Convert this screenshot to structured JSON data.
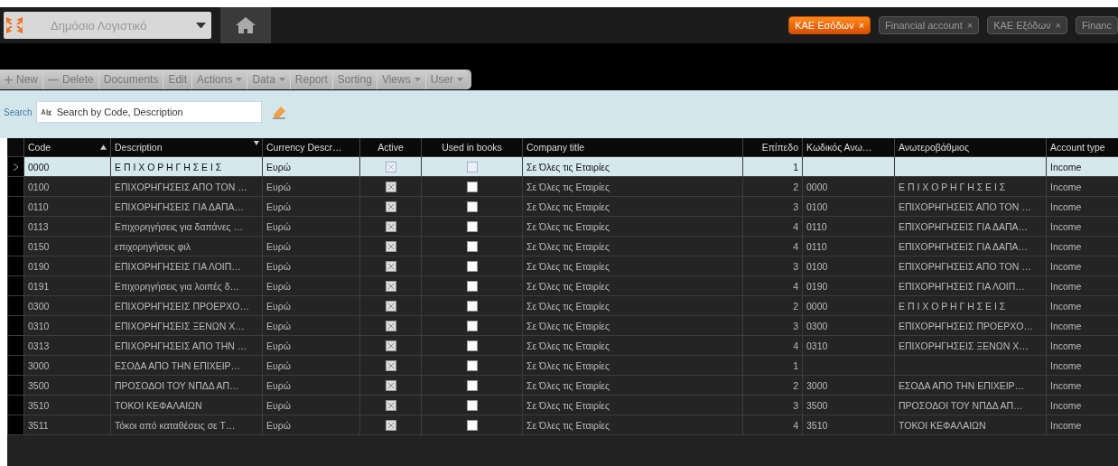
{
  "app_selector": {
    "value": "Δημόσιο Λογιστικό"
  },
  "open_tabs": [
    {
      "label": "ΚΑΕ Εσόδων",
      "close": "×",
      "selected": true
    },
    {
      "label": "Financial account",
      "close": "×",
      "selected": false
    },
    {
      "label": "ΚΑΕ Εξόδων",
      "close": "×",
      "selected": false
    },
    {
      "label": "Financ",
      "selected": false
    }
  ],
  "toolbar": [
    {
      "label": "New",
      "kind": "add"
    },
    {
      "label": "Delete",
      "kind": "remove"
    },
    {
      "label": "Documents",
      "kind": "plain"
    },
    {
      "label": "Edit",
      "kind": "plain"
    },
    {
      "label": "Actions",
      "kind": "menu"
    },
    {
      "label": "Data",
      "kind": "menu"
    },
    {
      "label": "Report",
      "kind": "plain"
    },
    {
      "label": "Sorting",
      "kind": "plain"
    },
    {
      "label": "Views",
      "kind": "menu"
    },
    {
      "label": "User",
      "kind": "menu"
    }
  ],
  "search": {
    "label": "Search",
    "placeholder": "Search by Code, Description"
  },
  "table": {
    "columns": [
      {
        "label": "Code",
        "sorted_ascending": true,
        "filter_mark": false
      },
      {
        "label": "Description",
        "sorted_ascending": false,
        "filter_mark": true
      },
      {
        "label": "Currency Descr…",
        "sorted_ascending": false,
        "filter_mark": false
      },
      {
        "label": "Active",
        "sorted_ascending": false,
        "filter_mark": false
      },
      {
        "label": "Used in books",
        "sorted_ascending": false,
        "filter_mark": false
      },
      {
        "label": "Company title",
        "sorted_ascending": false,
        "filter_mark": false
      },
      {
        "label": "Επίπεδο",
        "sorted_ascending": false,
        "filter_mark": false
      },
      {
        "label": "Κωδικός Ανω…",
        "sorted_ascending": false,
        "filter_mark": false
      },
      {
        "label": "Ανωτεροβάθμιος",
        "sorted_ascending": false,
        "filter_mark": false
      },
      {
        "label": "Account type",
        "sorted_ascending": false,
        "filter_mark": false
      }
    ],
    "rows": [
      {
        "selected": true,
        "code": "0000",
        "description": "Ε Π Ι Χ Ο Ρ Η Γ Η Σ Ε Ι Σ",
        "currency": "Ευρώ",
        "active": true,
        "used_in_books": false,
        "company": "Σε Όλες τις Εταιρίες",
        "level_no": "1",
        "account_type": "Income"
      },
      {
        "selected": false,
        "code": "0100",
        "description": "ΕΠΙΧΟΡΗΓΗΣΕΙΣ ΑΠΟ ΤΟΝ …",
        "currency": "Ευρώ",
        "active": true,
        "used_in_books": false,
        "company": "Σε Όλες τις Εταιρίες",
        "level_no": "2",
        "parent_code": "0000",
        "parent": "Ε Π Ι Χ Ο Ρ Η Γ Η Σ Ε Ι Σ",
        "account_type": "Income"
      },
      {
        "selected": false,
        "code": "0110",
        "description": "ΕΠΙΧΟΡΗΓΗΣΕΙΣ ΓΙΑ ΔΑΠΑ…",
        "currency": "Ευρώ",
        "active": true,
        "used_in_books": false,
        "company": "Σε Όλες τις Εταιρίες",
        "level_no": "3",
        "parent_code": "0100",
        "parent": "ΕΠΙΧΟΡΗΓΗΣΕΙΣ ΑΠΟ ΤΟΝ …",
        "account_type": "Income"
      },
      {
        "selected": false,
        "code": "0113",
        "description": "Επιχορηγήσεις για δαπάνες …",
        "currency": "Ευρώ",
        "active": true,
        "used_in_books": false,
        "company": "Σε Όλες τις Εταιρίες",
        "level_no": "4",
        "parent_code": "0110",
        "parent": "ΕΠΙΧΟΡΗΓΗΣΕΙΣ ΓΙΑ ΔΑΠΑ…",
        "account_type": "Income"
      },
      {
        "selected": false,
        "code": "0150",
        "description": "επιχορηγήσεις φιλ",
        "currency": "Ευρώ",
        "active": true,
        "used_in_books": false,
        "company": "Σε Όλες τις Εταιρίες",
        "level_no": "4",
        "parent_code": "0110",
        "parent": "ΕΠΙΧΟΡΗΓΗΣΕΙΣ ΓΙΑ ΔΑΠΑ…",
        "account_type": "Income"
      },
      {
        "selected": false,
        "code": "0190",
        "description": "ΕΠΙΧΟΡΗΓΗΣΕΙΣ ΓΙΑ ΛΟΙΠ…",
        "currency": "Ευρώ",
        "active": true,
        "used_in_books": false,
        "company": "Σε Όλες τις Εταιρίες",
        "level_no": "3",
        "parent_code": "0100",
        "parent": "ΕΠΙΧΟΡΗΓΗΣΕΙΣ ΑΠΟ ΤΟΝ …",
        "account_type": "Income"
      },
      {
        "selected": false,
        "code": "0191",
        "description": "Επιχορηγήσεις για λοιπές δ…",
        "currency": "Ευρώ",
        "active": true,
        "used_in_books": false,
        "company": "Σε Όλες τις Εταιρίες",
        "level_no": "4",
        "parent_code": "0190",
        "parent": "ΕΠΙΧΟΡΗΓΗΣΕΙΣ ΓΙΑ ΛΟΙΠ…",
        "account_type": "Income"
      },
      {
        "selected": false,
        "code": "0300",
        "description": "ΕΠΙΧΟΡΗΓΗΣΕΙΣ ΠΡΟΕΡΧΟ…",
        "currency": "Ευρώ",
        "active": true,
        "used_in_books": false,
        "company": "Σε Όλες τις Εταιρίες",
        "level_no": "2",
        "parent_code": "0000",
        "parent": "Ε Π Ι Χ Ο Ρ Η Γ Η Σ Ε Ι Σ",
        "account_type": "Income"
      },
      {
        "selected": false,
        "code": "0310",
        "description": "ΕΠΙΧΟΡΗΓΗΣΕΙΣ ΞΕΝΩΝ Χ…",
        "currency": "Ευρώ",
        "active": true,
        "used_in_books": false,
        "company": "Σε Όλες τις Εταιρίες",
        "level_no": "3",
        "parent_code": "0300",
        "parent": "ΕΠΙΧΟΡΗΓΗΣΕΙΣ ΠΡΟΕΡΧΟ…",
        "account_type": "Income"
      },
      {
        "selected": false,
        "code": "0313",
        "description": "ΕΠΙΧΟΡΗΓΗΣΕΙΣ ΑΠΟ ΤΗΝ …",
        "currency": "Ευρώ",
        "active": true,
        "used_in_books": false,
        "company": "Σε Όλες τις Εταιρίες",
        "level_no": "4",
        "parent_code": "0310",
        "parent": "ΕΠΙΧΟΡΗΓΗΣΕΙΣ ΞΕΝΩΝ Χ…",
        "account_type": "Income"
      },
      {
        "selected": false,
        "code": "3000",
        "description": "ΕΣΟΔΑ ΑΠΟ ΤΗΝ ΕΠΙΧΕΙΡ…",
        "currency": "Ευρώ",
        "active": true,
        "used_in_books": false,
        "company": "Σε Όλες τις Εταιρίες",
        "level_no": "1",
        "account_type": "Income"
      },
      {
        "selected": false,
        "code": "3500",
        "description": "ΠΡΟΣΟΔΟΙ ΤΟΥ ΝΠΔΔ ΑΠ…",
        "currency": "Ευρώ",
        "active": true,
        "used_in_books": false,
        "company": "Σε Όλες τις Εταιρίες",
        "level_no": "2",
        "parent_code": "3000",
        "parent": "ΕΣΟΔΑ ΑΠΟ ΤΗΝ ΕΠΙΧΕΙΡ…",
        "account_type": "Income"
      },
      {
        "selected": false,
        "code": "3510",
        "description": "ΤΟΚΟΙ ΚΕΦΑΛΑΙΩΝ",
        "currency": "Ευρώ",
        "active": true,
        "used_in_books": false,
        "company": "Σε Όλες τις Εταιρίες",
        "level_no": "3",
        "parent_code": "3500",
        "parent": "ΠΡΟΣΟΔΟΙ ΤΟΥ ΝΠΔΔ ΑΠ…",
        "account_type": "Income"
      },
      {
        "selected": false,
        "code": "3511",
        "description": "Τόκοι από καταθέσεις σε Τ…",
        "currency": "Ευρώ",
        "active": true,
        "used_in_books": false,
        "company": "Σε Όλες τις Εταιρίες",
        "level_no": "4",
        "parent_code": "3510",
        "parent": "ΤΟΚΟΙ ΚΕΦΑΛΑΙΩΝ",
        "account_type": "Income"
      }
    ]
  }
}
